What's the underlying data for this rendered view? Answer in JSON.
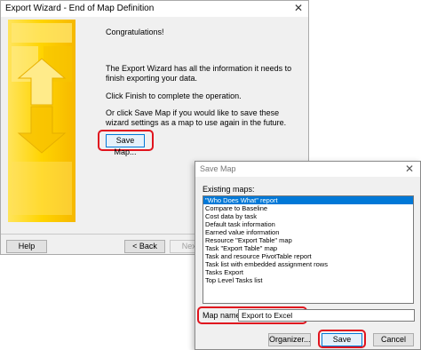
{
  "wizard": {
    "title": "Export Wizard - End of Map Definition",
    "close_glyph": "✕",
    "congrats": "Congratulations!",
    "info": "The Export Wizard has all the information it needs to finish exporting your data.",
    "finish_hint": "Click Finish to complete the operation.",
    "save_hint": "Or click Save Map if you would like to save these wizard settings as a map to use again in the future.",
    "save_map_button": "Save Map...",
    "help_button": "Help",
    "back_button": "< Back",
    "next_button": "Next"
  },
  "dialog": {
    "title": "Save Map",
    "close_glyph": "✕",
    "existing_label": "Existing maps:",
    "maps": [
      "\"Who Does What\" report",
      "Compare to Baseline",
      "Cost data by task",
      "Default task information",
      "Earned value information",
      "Resource \"Export Table\" map",
      "Task \"Export Table\" map",
      "Task and resource PivotTable report",
      "Task list with embedded assignment rows",
      "Tasks Export",
      "Top Level Tasks list"
    ],
    "selected_index": 0,
    "map_name_label": "Map name:",
    "map_name_value": "Export to Excel",
    "organizer_button": "Organizer...",
    "save_button": "Save",
    "cancel_button": "Cancel"
  },
  "colors": {
    "highlight": "#e0141e",
    "selection": "#0078d7",
    "graphic_yellow": "#ffd400"
  }
}
